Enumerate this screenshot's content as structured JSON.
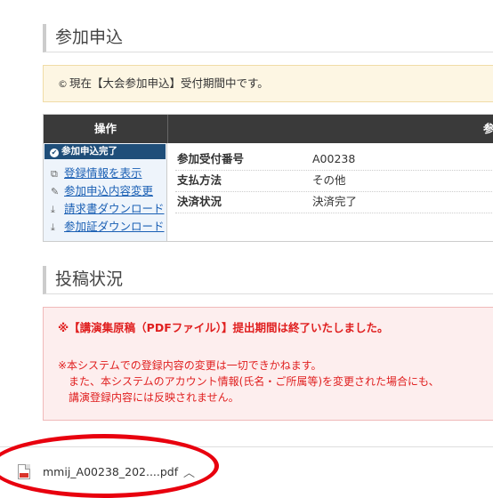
{
  "sections": {
    "registration_title": "参加申込",
    "submission_title": "投稿状況"
  },
  "notice_yellow": {
    "icon": "info-icon",
    "text": "現在【大会参加申込】受付期間中です。"
  },
  "table": {
    "header_left": "操作",
    "header_right": "参加",
    "status_badge": "参加申込完了",
    "actions": [
      {
        "icon": "copy-icon",
        "label": "登録情報を表示"
      },
      {
        "icon": "pencil-icon",
        "label": "参加申込内容変更"
      },
      {
        "icon": "download-icon",
        "label": "請求書ダウンロード"
      },
      {
        "icon": "download-icon",
        "label": "参加証ダウンロード"
      }
    ],
    "rows": [
      {
        "label": "参加受付番号",
        "value": "A00238"
      },
      {
        "label": "支払方法",
        "value": "その他"
      },
      {
        "label": "決済状況",
        "value": "決済完了"
      }
    ]
  },
  "notice_red": {
    "headline": "※【講演集原稿（PDFファイル）】提出期間は終了いたしました。",
    "lines": [
      "※本システムでの登録内容の変更は一切できかねます。",
      "　また、本システムのアカウント情報(氏名・ご所属等)を変更された場合にも、",
      "　講演登録内容には反映されません。"
    ]
  },
  "download_bar": {
    "file_name": "mmij_A00238_202....pdf",
    "file_icon": "pdf-file-icon",
    "chevron_icon": "chevron-up-icon"
  },
  "colors": {
    "accent_blue": "#1f4e79",
    "link_blue": "#1a5fb4",
    "notice_red": "#e02020",
    "highlight_circle": "#e8000e"
  }
}
